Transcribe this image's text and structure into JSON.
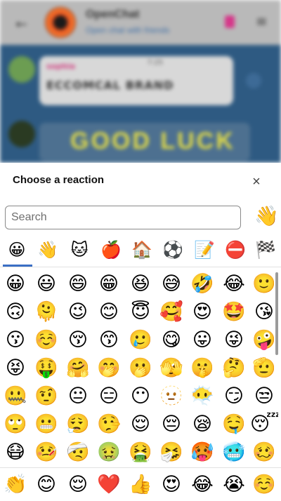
{
  "chat": {
    "title": "OpenChat",
    "subtitle": "Open chat with friends",
    "message_author": "sophia",
    "message_time": "7:25",
    "message_text": "ECCOMCAL BRAND",
    "sticker_text": "GOOD LUCK"
  },
  "sheet": {
    "title": "Choose a reaction",
    "close_icon": "×",
    "search_placeholder": "Search",
    "wave_emoji": "👋"
  },
  "tabs": [
    "😀",
    "👋",
    "🐱",
    "🍎",
    "🏠",
    "⚽",
    "📝",
    "⛔",
    "🏁"
  ],
  "grid": [
    [
      "😀",
      "😃",
      "😄",
      "😁",
      "😆",
      "😅",
      "🤣",
      "😂",
      "🙂"
    ],
    [
      "🙃",
      "🫠",
      "😉",
      "😊",
      "😇",
      "🥰",
      "😍",
      "🤩",
      "😘"
    ],
    [
      "😗",
      "☺️",
      "😚",
      "😙",
      "🥲",
      "😋",
      "😛",
      "😜",
      "🤪"
    ],
    [
      "😝",
      "🤑",
      "🤗",
      "🤭",
      "🫢",
      "🫣",
      "🤫",
      "🤔",
      "🫡"
    ],
    [
      "🤐",
      "🤨",
      "😐",
      "😑",
      "😶",
      "🫥",
      "😶‍🌫️",
      "😏",
      "😒"
    ],
    [
      "🙄",
      "😬",
      "😮‍💨",
      "🤥",
      "😌",
      "😔",
      "😪",
      "🤤",
      "😴"
    ],
    [
      "😷",
      "🤒",
      "🤕",
      "🤢",
      "🤮",
      "🤧",
      "🥵",
      "🥶",
      "🥴"
    ]
  ],
  "recent": [
    "👏",
    "😊",
    "😌",
    "❤️",
    "👍",
    "😍",
    "😂",
    "😭",
    "☺️"
  ]
}
